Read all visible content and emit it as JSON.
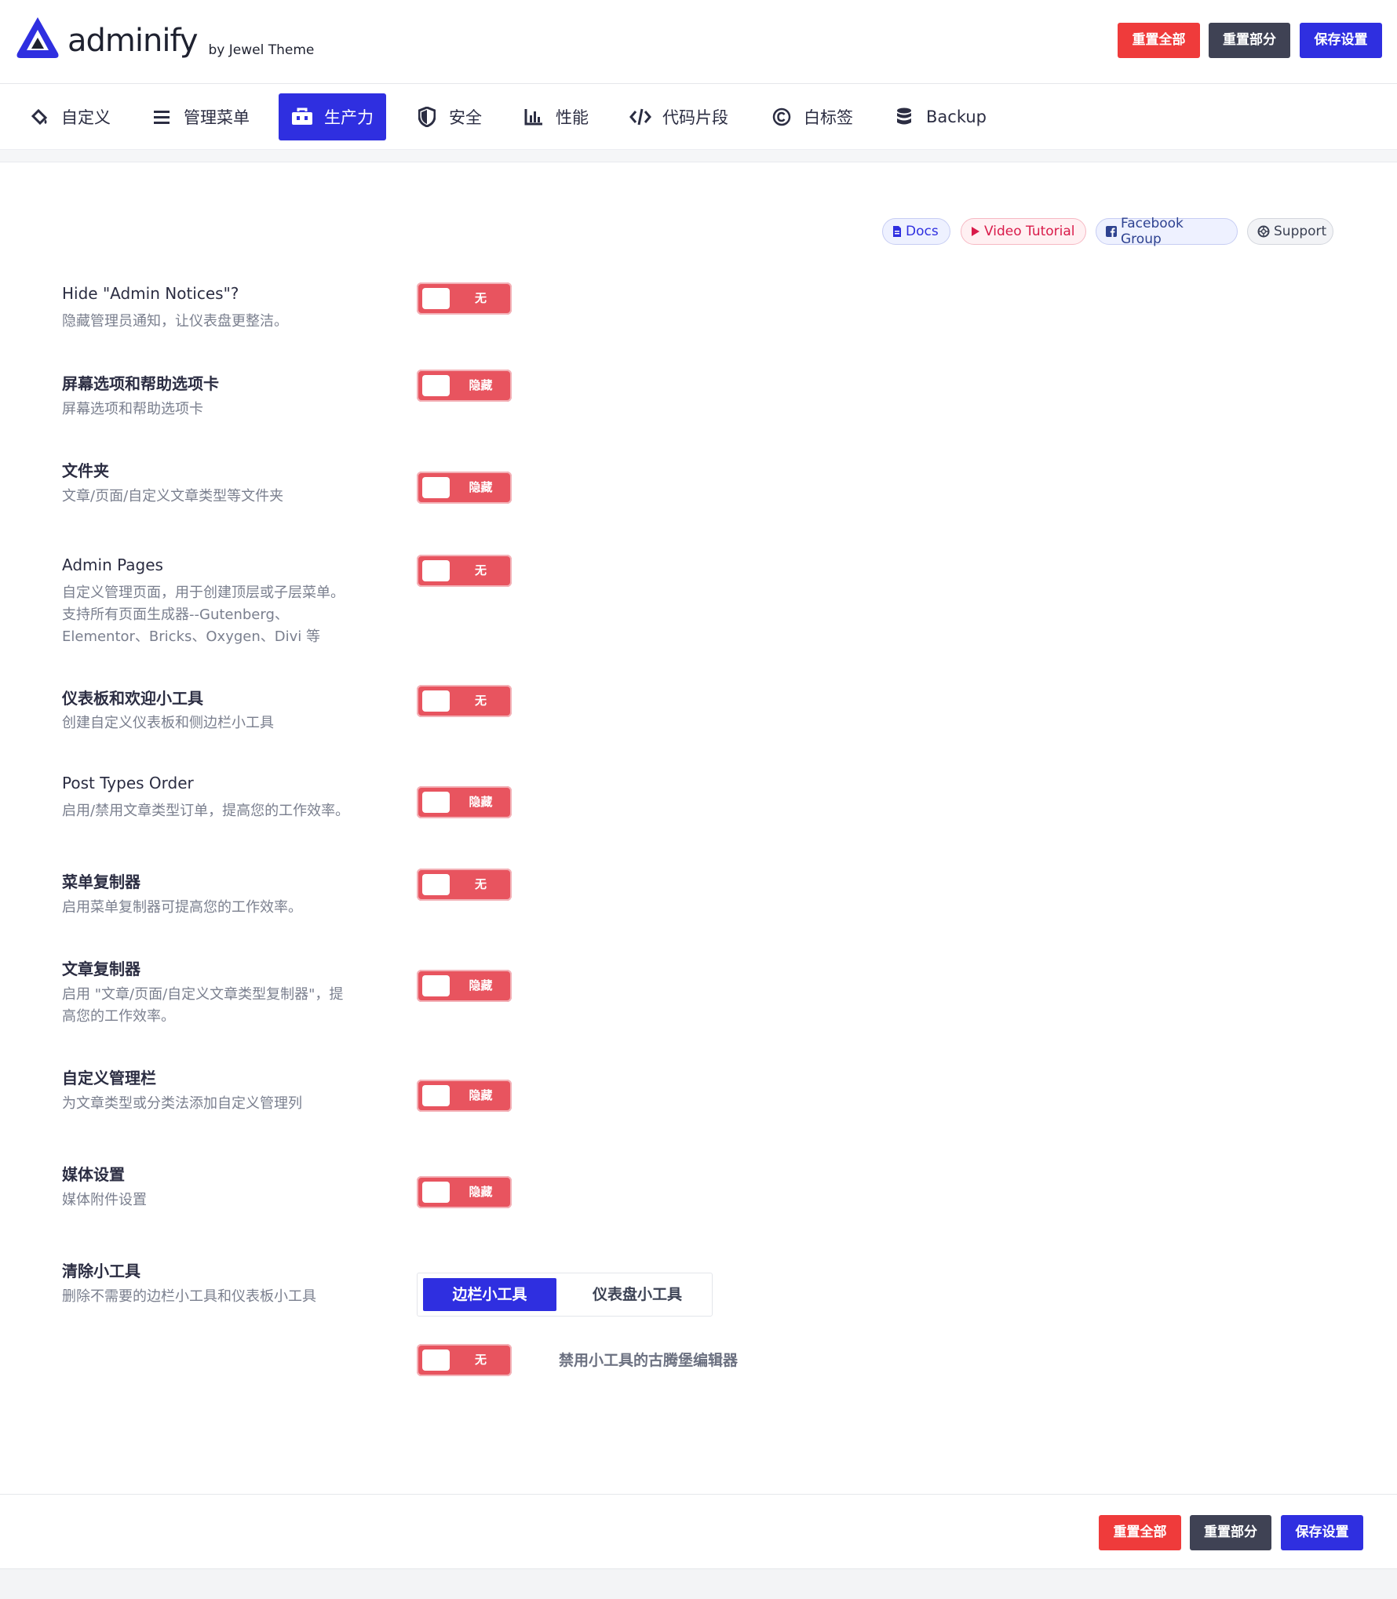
{
  "brand": {
    "name": "adminify",
    "byline": "by Jewel Theme",
    "color": "#2f2fe0"
  },
  "header_actions": {
    "reset_all": "重置全部",
    "reset_section": "重置部分",
    "save": "保存设置"
  },
  "tabs": [
    {
      "label": "自定义",
      "icon": "paint-bucket-icon",
      "active": false
    },
    {
      "label": "管理菜单",
      "icon": "list-icon",
      "active": false
    },
    {
      "label": "生产力",
      "icon": "toolbox-icon",
      "active": true
    },
    {
      "label": "安全",
      "icon": "shield-icon",
      "active": false
    },
    {
      "label": "性能",
      "icon": "bar-chart-icon",
      "active": false
    },
    {
      "label": "代码片段",
      "icon": "code-icon",
      "active": false
    },
    {
      "label": "白标签",
      "icon": "copyright-icon",
      "active": false
    },
    {
      "label": "Backup",
      "icon": "database-icon",
      "active": false
    }
  ],
  "help_links": {
    "docs": "Docs",
    "video": "Video Tutorial",
    "facebook": "Facebook Group",
    "support": "Support"
  },
  "settings": [
    {
      "title": "Hide \"Admin Notices\"?",
      "desc": [
        "隐藏管理员通知，让仪表盘更整洁。"
      ],
      "toggle": "无"
    },
    {
      "title": "屏幕选项和帮助选项卡",
      "desc": [
        "屏幕选项和帮助选项卡"
      ],
      "toggle": "隐藏"
    },
    {
      "title": "文件夹",
      "desc": [
        "文章/页面/自定义文章类型等文件夹"
      ],
      "toggle": "隐藏"
    },
    {
      "title": "Admin Pages",
      "desc": [
        "自定义管理页面，用于创建顶层或子层菜单。",
        "支持所有页面生成器--Gutenberg、",
        "Elementor、Bricks、Oxygen、Divi 等"
      ],
      "toggle": "无"
    },
    {
      "title": "仪表板和欢迎小工具",
      "desc": [
        "创建自定义仪表板和侧边栏小工具"
      ],
      "toggle": "无"
    },
    {
      "title": "Post Types Order",
      "desc": [
        "启用/禁用文章类型订单，提高您的工作效率。"
      ],
      "toggle": "隐藏"
    },
    {
      "title": "菜单复制器",
      "desc": [
        "启用菜单复制器可提高您的工作效率。"
      ],
      "toggle": "无"
    },
    {
      "title": "文章复制器",
      "desc": [
        "启用 \"文章/页面/自定义文章类型复制器\"，提",
        "高您的工作效率。"
      ],
      "toggle": "隐藏"
    },
    {
      "title": "自定义管理栏",
      "desc": [
        "为文章类型或分类法添加自定义管理列"
      ],
      "toggle": "隐藏"
    },
    {
      "title": "媒体设置",
      "desc": [
        "媒体附件设置"
      ],
      "toggle": "隐藏"
    }
  ],
  "widgets": {
    "title": "清除小工具",
    "desc": "删除不需要的边栏小工具和仪表板小工具",
    "segments": [
      "边栏小工具",
      "仪表盘小工具"
    ],
    "active_segment": "边栏小工具",
    "gutenberg_toggle": "无",
    "gutenberg_label": "禁用小工具的古腾堡编辑器"
  },
  "footer_actions": {
    "reset_all": "重置全部",
    "reset_section": "重置部分",
    "save": "保存设置"
  },
  "colors": {
    "primary": "#2f2fe0",
    "danger": "#ef3b3b",
    "dark": "#3f4254",
    "toggle_off": "#e8545f"
  }
}
